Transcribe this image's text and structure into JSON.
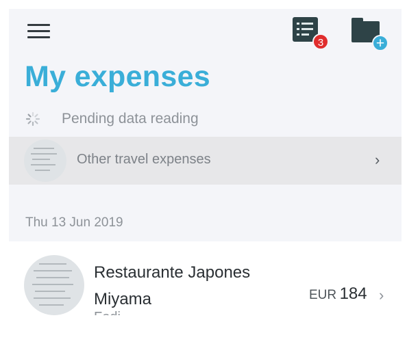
{
  "header": {
    "menu_icon": "hamburger-menu-icon",
    "reports_icon": "report-list-icon",
    "reports_badge": "3",
    "add_folder_icon": "folder-add-icon",
    "title": "My expenses"
  },
  "pending": {
    "icon": "loading-spinner-icon",
    "label": "Pending data reading"
  },
  "group": {
    "label": "Other travel expenses",
    "icon": "chevron-right-icon"
  },
  "date_header": "Thu 13 Jun 2019",
  "expense": {
    "merchant": "Restaurante Japones Miyama",
    "sub": "Fodi",
    "currency": "EUR",
    "amount": "184"
  },
  "colors": {
    "accent": "#3aaed8",
    "badge": "#e02d2d",
    "icon_dark": "#2e4347",
    "background": "#f4f5f9"
  }
}
